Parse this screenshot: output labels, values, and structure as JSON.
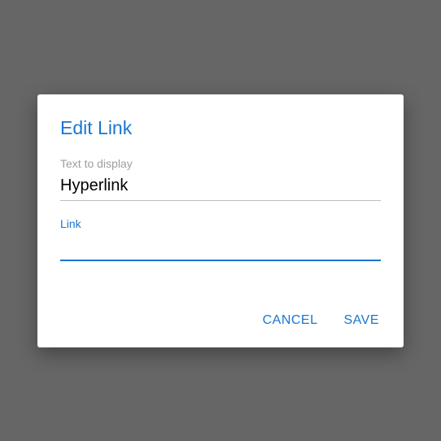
{
  "dialog": {
    "title": "Edit Link",
    "fields": {
      "text": {
        "label": "Text to display",
        "value": "Hyperlink"
      },
      "link": {
        "label": "Link",
        "value": ""
      }
    },
    "actions": {
      "cancel": "CANCEL",
      "save": "SAVE"
    }
  },
  "colors": {
    "primary": "#1976d2",
    "background": "#666666",
    "surface": "#ffffff",
    "labelInactive": "#9e9e9e",
    "underlineInactive": "#bdbdbd"
  }
}
